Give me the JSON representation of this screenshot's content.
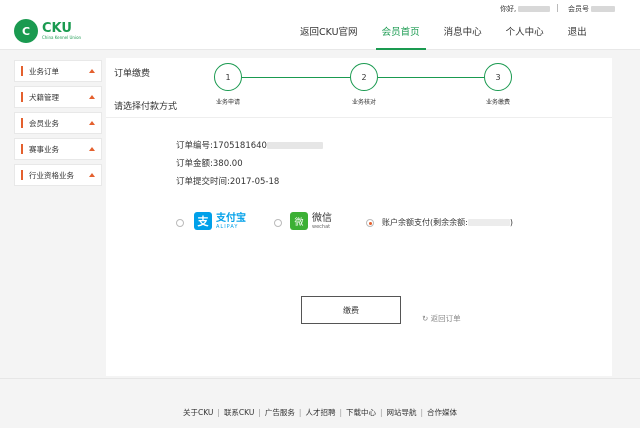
{
  "topbar": {
    "greeting": "你好,",
    "separator": "|",
    "member_label": "会员号"
  },
  "logo": {
    "mark": "C",
    "name": "CKU",
    "tagline": "China Kennel Union"
  },
  "nav": {
    "items": [
      {
        "label": "返回CKU官网"
      },
      {
        "label": "会员首页"
      },
      {
        "label": "消息中心"
      },
      {
        "label": "个人中心"
      },
      {
        "label": "退出"
      }
    ],
    "active_index": 1
  },
  "sidebar": {
    "items": [
      {
        "label": "业务订单"
      },
      {
        "label": "犬籍管理"
      },
      {
        "label": "会员业务"
      },
      {
        "label": "赛事业务"
      },
      {
        "label": "行业资格业务"
      }
    ]
  },
  "order": {
    "section_title": "订单缴费",
    "steps": [
      {
        "number": "1",
        "label": "业务申请"
      },
      {
        "number": "2",
        "label": "业务核对"
      },
      {
        "number": "3",
        "label": "业务缴费"
      }
    ],
    "number_label": "订单编号:",
    "number_value": "1705181640",
    "amount_label": "订单金额:",
    "amount_value": "380.00",
    "time_label": "订单提交时间:",
    "time_value": "2017-05-18"
  },
  "payment": {
    "section_title": "请选择付款方式",
    "alipay_mark": "支",
    "alipay_cn": "支付宝",
    "alipay_en": "ALIPAY",
    "wechat_mark": "微",
    "wechat_cn": "微信",
    "wechat_en": "wechat",
    "balance_label": "账户余额支付(剩余余额:",
    "balance_close": ")",
    "pay_button": "缴费",
    "back_link": "↻ 返回订单"
  },
  "footer": {
    "links": [
      "关于CKU",
      "联系CKU",
      "广告服务",
      "人才招聘",
      "下载中心",
      "网站导航",
      "合作媒体"
    ],
    "separator": "|"
  },
  "colors": {
    "brand_green": "#1a9a50",
    "accent_orange": "#e4602e",
    "alipay_blue": "#00a0e9",
    "wechat_green": "#3cb035"
  }
}
